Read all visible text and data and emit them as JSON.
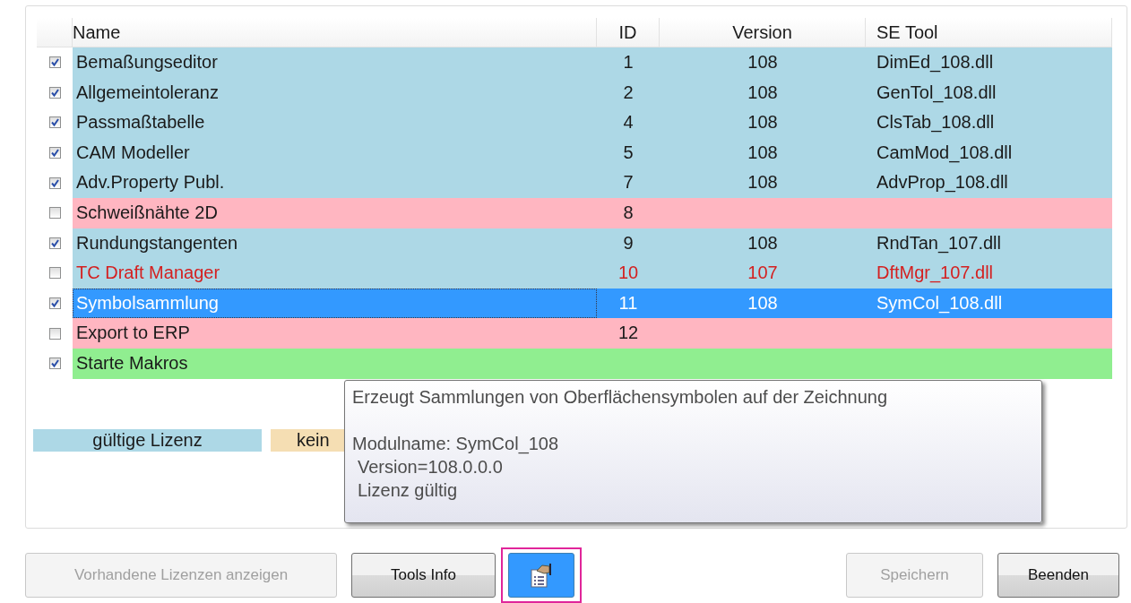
{
  "table": {
    "columns": [
      "Name",
      "ID",
      "Version",
      "SE Tool"
    ],
    "rows": [
      {
        "checked": true,
        "name": "Bemaßungseditor",
        "id": "1",
        "version": "108",
        "tool": "DimEd_108.dll",
        "color": "#add8e6",
        "warning": false,
        "selected": false
      },
      {
        "checked": true,
        "name": "Allgemeintoleranz",
        "id": "2",
        "version": "108",
        "tool": "GenTol_108.dll",
        "color": "#add8e6",
        "warning": false,
        "selected": false
      },
      {
        "checked": true,
        "name": "Passmaßtabelle",
        "id": "4",
        "version": "108",
        "tool": "ClsTab_108.dll",
        "color": "#add8e6",
        "warning": false,
        "selected": false
      },
      {
        "checked": true,
        "name": "CAM Modeller",
        "id": "5",
        "version": "108",
        "tool": "CamMod_108.dll",
        "color": "#add8e6",
        "warning": false,
        "selected": false
      },
      {
        "checked": true,
        "name": "Adv.Property Publ.",
        "id": "7",
        "version": "108",
        "tool": "AdvProp_108.dll",
        "color": "#add8e6",
        "warning": false,
        "selected": false
      },
      {
        "checked": false,
        "name": "Schweißnähte 2D",
        "id": "8",
        "color": "#ffb6c1",
        "warning": false,
        "selected": false
      },
      {
        "checked": true,
        "name": "Rundungstangenten",
        "id": "9",
        "version": "108",
        "tool": "RndTan_107.dll",
        "color": "#add8e6",
        "warning": false,
        "selected": false
      },
      {
        "checked": false,
        "name": "TC Draft Manager",
        "id": "10",
        "version": "107",
        "tool": "DftMgr_107.dll",
        "color": "#add8e6",
        "warning": true,
        "selected": false
      },
      {
        "checked": true,
        "name": "Symbolsammlung",
        "id": "11",
        "version": "108",
        "tool": "SymCol_108.dll",
        "selected": true
      },
      {
        "checked": false,
        "name": "Export to ERP",
        "id": "12",
        "color": "#ffb6c1",
        "warning": false,
        "selected": false
      },
      {
        "checked": true,
        "name": "Starte Makros",
        "color": "#90ee90",
        "warning": false,
        "selected": false
      }
    ]
  },
  "legend": [
    {
      "label": "gültige Lizenz",
      "color": "#add8e6"
    },
    {
      "label": "kein",
      "color": "#f5deb3"
    }
  ],
  "tooltip": {
    "lines": [
      "Erzeugt Sammlungen von Oberflächensymbolen auf der Zeichnung",
      "Modulname: SymCol_108",
      "Version=108.0.0.0",
      "Lizenz gültig"
    ]
  },
  "buttons": [
    {
      "kind": "text",
      "label": "Vorhandene Lizenzen anzeigen",
      "disabled": true
    },
    {
      "kind": "text",
      "label": "Tools Info",
      "disabled": false
    },
    {
      "kind": "icon",
      "highlighted": true
    },
    {
      "kind": "spacer"
    },
    {
      "kind": "text",
      "label": "Speichern",
      "disabled": true
    },
    {
      "kind": "text",
      "label": "Beenden",
      "disabled": false
    }
  ]
}
